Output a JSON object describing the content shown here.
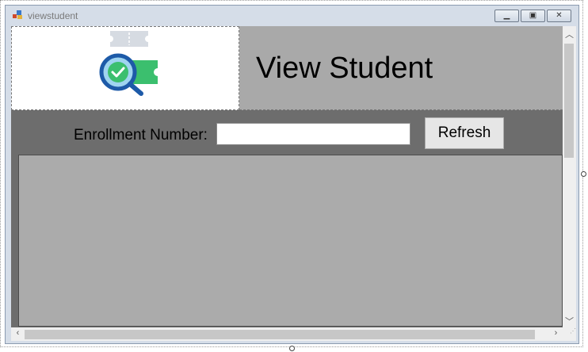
{
  "window": {
    "title": "viewstudent"
  },
  "header": {
    "title": "View Student",
    "logo_icon": "ticket-search-check-icon"
  },
  "form": {
    "enrollment_label": "Enrollment Number:",
    "enrollment_value": "",
    "refresh_label": "Refresh"
  },
  "colors": {
    "header_bg": "#a9a9a9",
    "form_bg": "#6d6d6d",
    "grid_bg": "#ababab"
  }
}
